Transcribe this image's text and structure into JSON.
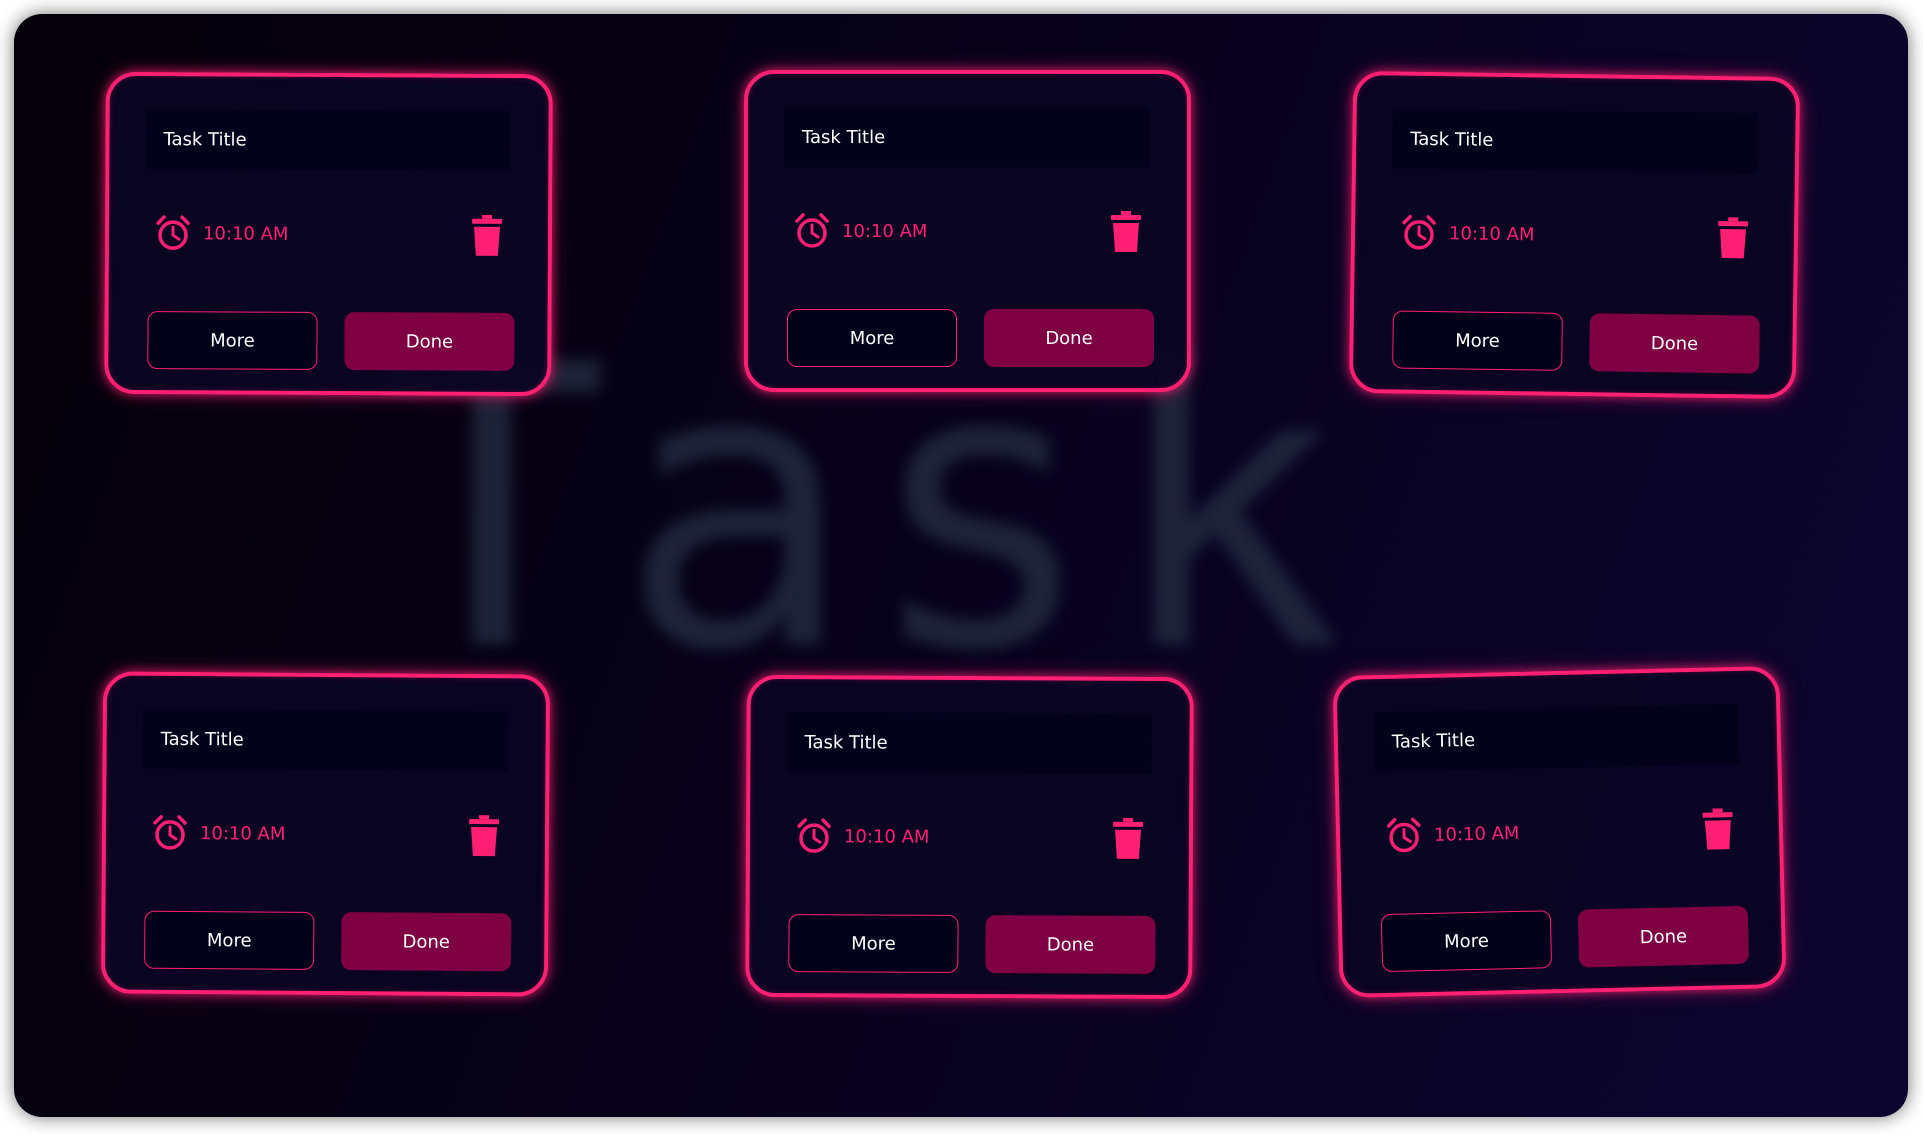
{
  "watermark": "Task",
  "colors": {
    "accent": "#ff1f73",
    "done_button": "#7e0043",
    "card_background": "#0a0422",
    "title_background": "#03021a"
  },
  "icons": {
    "alarm": "alarm-clock-icon",
    "delete": "trash-icon"
  },
  "cards": [
    {
      "title": "Task Title",
      "time": "10:10 AM",
      "more_label": "More",
      "done_label": "Done"
    },
    {
      "title": "Task Title",
      "time": "10:10 AM",
      "more_label": "More",
      "done_label": "Done"
    },
    {
      "title": "Task Title",
      "time": "10:10 AM",
      "more_label": "More",
      "done_label": "Done"
    },
    {
      "title": "Task Title",
      "time": "10:10 AM",
      "more_label": "More",
      "done_label": "Done"
    },
    {
      "title": "Task Title",
      "time": "10:10 AM",
      "more_label": "More",
      "done_label": "Done"
    },
    {
      "title": "Task Title",
      "time": "10:10 AM",
      "more_label": "More",
      "done_label": "Done"
    }
  ]
}
